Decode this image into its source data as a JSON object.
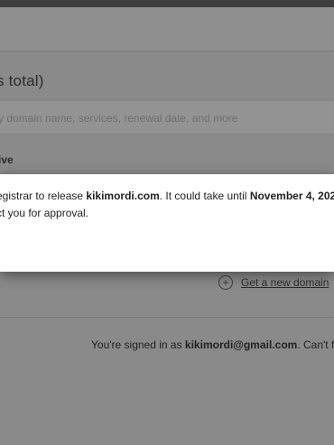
{
  "header": {
    "count_title": "s total)"
  },
  "search": {
    "placeholder": "y domain name, services, renewal date, and more"
  },
  "filter": {
    "label": "tive"
  },
  "dialog": {
    "line1_prefix": "egistrar to release ",
    "domain": "kikimordi.com",
    "line1_mid": ". It could take until ",
    "date": "November 4, 202",
    "line2": "ct you for approval."
  },
  "actions": {
    "new_domain_label": "Get a new domain"
  },
  "footer": {
    "signed_prefix": "You're signed in as ",
    "email": "kikimordi@gmail.com",
    "signed_suffix": ". Can't fir"
  }
}
